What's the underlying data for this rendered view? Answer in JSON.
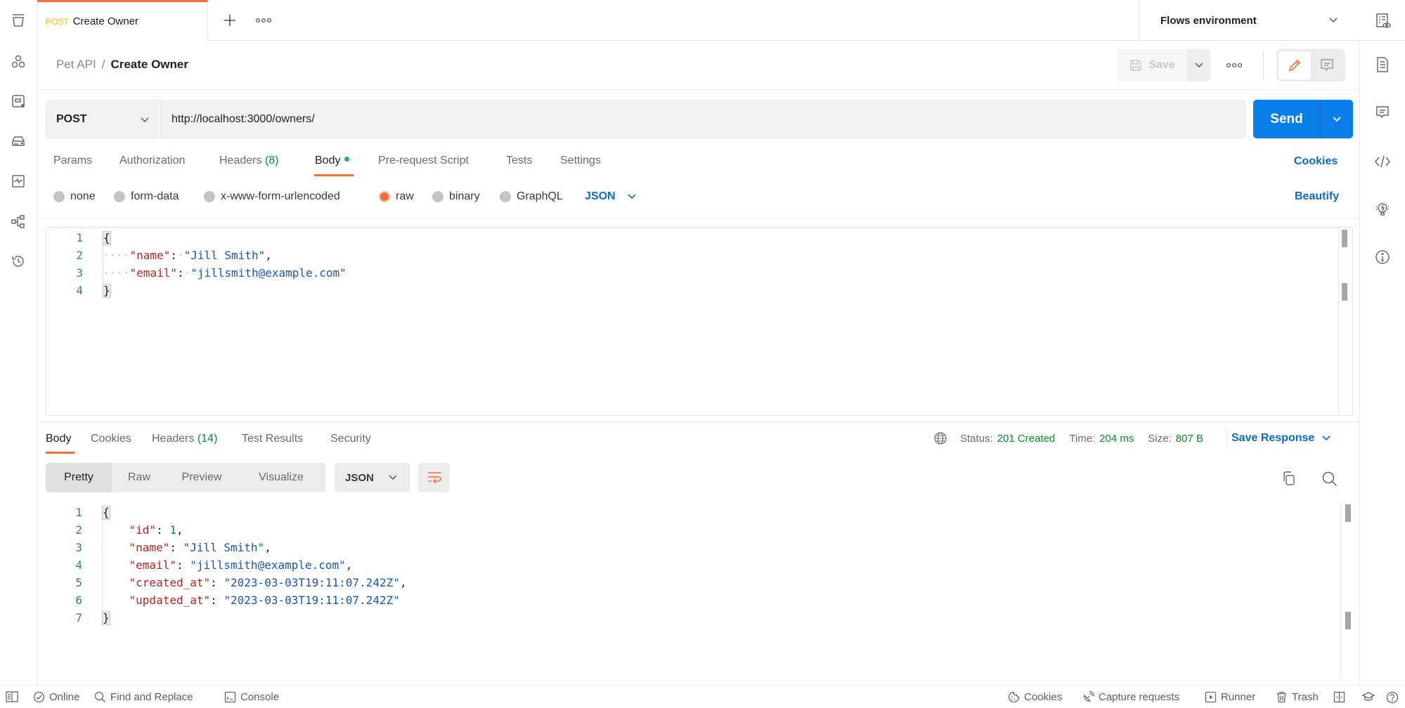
{
  "tabs": [
    {
      "method": "POST",
      "title": "Create Owner",
      "method_color": "#f5b91a"
    }
  ],
  "environment": {
    "label": "Flows environment"
  },
  "breadcrumb": {
    "parent": "Pet API",
    "separator": "/",
    "current": "Create Owner"
  },
  "toolbar": {
    "save_label": "Save"
  },
  "request": {
    "method": "POST",
    "url": "http://localhost:3000/owners/",
    "send_label": "Send",
    "tabs": [
      {
        "label": "Params"
      },
      {
        "label": "Authorization"
      },
      {
        "label": "Headers",
        "count": "(8)"
      },
      {
        "label": "Body",
        "active": true,
        "modified": true
      },
      {
        "label": "Pre-request Script"
      },
      {
        "label": "Tests"
      },
      {
        "label": "Settings"
      }
    ],
    "cookies_link": "Cookies",
    "body_types": [
      {
        "label": "none"
      },
      {
        "label": "form-data"
      },
      {
        "label": "x-www-form-urlencoded"
      },
      {
        "label": "raw",
        "selected": true
      },
      {
        "label": "binary"
      },
      {
        "label": "GraphQL"
      }
    ],
    "raw_format": "JSON",
    "beautify_label": "Beautify",
    "body_lines": [
      {
        "n": "1",
        "text": "{"
      },
      {
        "n": "2",
        "key": "\"name\"",
        "value": "\"Jill Smith\"",
        "trail": ","
      },
      {
        "n": "3",
        "key": "\"email\"",
        "value": "\"jillsmith@example.com\"",
        "trail": ""
      },
      {
        "n": "4",
        "text": "}"
      }
    ]
  },
  "response": {
    "tabs": [
      {
        "label": "Body",
        "active": true
      },
      {
        "label": "Cookies"
      },
      {
        "label": "Headers",
        "count": "(14)"
      },
      {
        "label": "Test Results"
      },
      {
        "label": "Security"
      }
    ],
    "status_label": "Status:",
    "status": "201 Created",
    "time_label": "Time:",
    "time": "204 ms",
    "size_label": "Size:",
    "size": "807 B",
    "save_response_label": "Save Response",
    "views": [
      "Pretty",
      "Raw",
      "Preview",
      "Visualize"
    ],
    "active_view": "Pretty",
    "format": "JSON",
    "body_lines": [
      {
        "n": "1",
        "text": "{"
      },
      {
        "n": "2",
        "key": "\"id\"",
        "num": "1",
        "trail": ","
      },
      {
        "n": "3",
        "key": "\"name\"",
        "value": "\"Jill Smith\"",
        "trail": ","
      },
      {
        "n": "4",
        "key": "\"email\"",
        "value": "\"jillsmith@example.com\"",
        "trail": ","
      },
      {
        "n": "5",
        "key": "\"created_at\"",
        "value": "\"2023-03-03T19:11:07.242Z\"",
        "trail": ","
      },
      {
        "n": "6",
        "key": "\"updated_at\"",
        "value": "\"2023-03-03T19:11:07.242Z\"",
        "trail": ""
      },
      {
        "n": "7",
        "text": "}"
      }
    ]
  },
  "statusbar": {
    "online": "Online",
    "find_replace": "Find and Replace",
    "console": "Console",
    "cookies": "Cookies",
    "capture": "Capture requests",
    "runner": "Runner",
    "trash": "Trash"
  },
  "colors": {
    "accent": "#ff6c37",
    "primary": "#0b7fe9",
    "success": "#0c8a2a"
  }
}
